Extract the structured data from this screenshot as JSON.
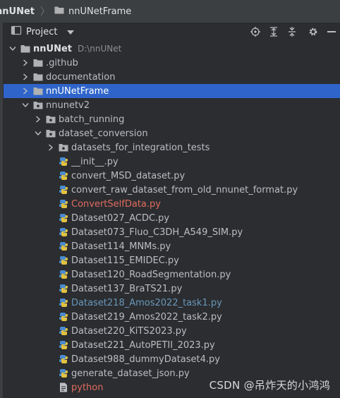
{
  "breadcrumb": {
    "root": "nnUNet",
    "child": "nnUNetFrame"
  },
  "toolwindow": {
    "title": "Project"
  },
  "colors": {
    "background": "#2b2d30",
    "selection": "#2f65ca",
    "text": "#bcbec4",
    "modified_red": "#e26b5f",
    "vcs_blue": "#6897bb",
    "folder": "#afb1b3"
  },
  "tree": [
    {
      "label": "nnUNet",
      "path": "D:\\nnUNet",
      "depth": 0,
      "expanded": true,
      "icon": "folder-icon",
      "bold": true
    },
    {
      "label": ".github",
      "depth": 1,
      "expanded": false,
      "icon": "folder-icon"
    },
    {
      "label": "documentation",
      "depth": 1,
      "expanded": false,
      "icon": "folder-icon"
    },
    {
      "label": "nnUNetFrame",
      "depth": 1,
      "expanded": false,
      "icon": "folder-icon",
      "selected": true
    },
    {
      "label": "nnunetv2",
      "depth": 1,
      "expanded": true,
      "icon": "package-icon"
    },
    {
      "label": "batch_running",
      "depth": 2,
      "expanded": false,
      "icon": "package-icon"
    },
    {
      "label": "dataset_conversion",
      "depth": 2,
      "expanded": true,
      "icon": "package-icon"
    },
    {
      "label": "datasets_for_integration_tests",
      "depth": 3,
      "expanded": false,
      "icon": "package-icon"
    },
    {
      "label": "__init__.py",
      "depth": 3,
      "icon": "python-file-icon"
    },
    {
      "label": "convert_MSD_dataset.py",
      "depth": 3,
      "icon": "python-file-icon"
    },
    {
      "label": "convert_raw_dataset_from_old_nnunet_format.py",
      "depth": 3,
      "icon": "python-file-icon"
    },
    {
      "label": "ConvertSelfData.py",
      "depth": 3,
      "icon": "python-file-icon",
      "color": "red"
    },
    {
      "label": "Dataset027_ACDC.py",
      "depth": 3,
      "icon": "python-file-icon"
    },
    {
      "label": "Dataset073_Fluo_C3DH_A549_SIM.py",
      "depth": 3,
      "icon": "python-file-icon"
    },
    {
      "label": "Dataset114_MNMs.py",
      "depth": 3,
      "icon": "python-file-icon"
    },
    {
      "label": "Dataset115_EMIDEC.py",
      "depth": 3,
      "icon": "python-file-icon"
    },
    {
      "label": "Dataset120_RoadSegmentation.py",
      "depth": 3,
      "icon": "python-file-icon"
    },
    {
      "label": "Dataset137_BraTS21.py",
      "depth": 3,
      "icon": "python-file-icon"
    },
    {
      "label": "Dataset218_Amos2022_task1.py",
      "depth": 3,
      "icon": "python-file-icon",
      "color": "blue"
    },
    {
      "label": "Dataset219_Amos2022_task2.py",
      "depth": 3,
      "icon": "python-file-icon"
    },
    {
      "label": "Dataset220_KiTS2023.py",
      "depth": 3,
      "icon": "python-file-icon"
    },
    {
      "label": "Dataset221_AutoPETII_2023.py",
      "depth": 3,
      "icon": "python-file-icon"
    },
    {
      "label": "Dataset988_dummyDataset4.py",
      "depth": 3,
      "icon": "python-file-icon"
    },
    {
      "label": "generate_dataset_json.py",
      "depth": 3,
      "icon": "python-file-icon"
    },
    {
      "label": "python",
      "depth": 3,
      "icon": "text-file-icon",
      "color": "red"
    }
  ],
  "watermark": "CSDN @吊炸天的小鸿鸿"
}
